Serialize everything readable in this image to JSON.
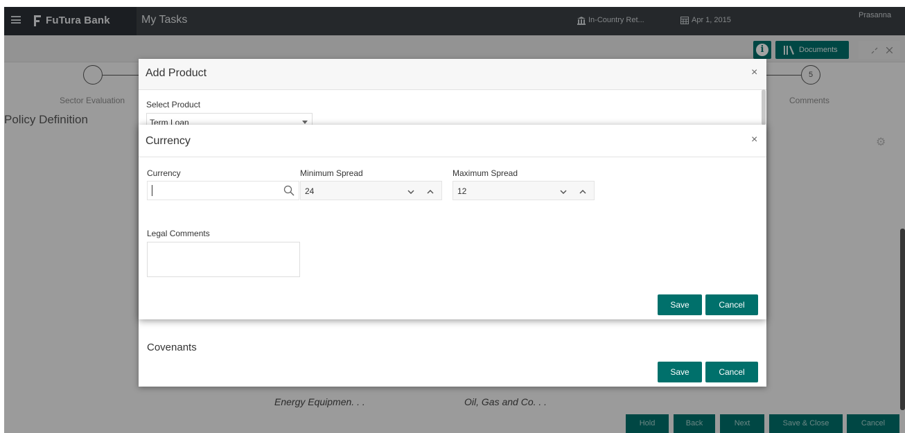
{
  "topbar": {
    "brand": "FuTura Bank",
    "title": "My Tasks",
    "branch": "In-Country Ret...",
    "date": "Apr 1, 2015",
    "user": "Prasanna"
  },
  "toolbar": {
    "documents_label": "Documents"
  },
  "steps": [
    {
      "label": "Sector Evaluation"
    },
    {
      "label": "Comments",
      "number": "5"
    }
  ],
  "page": {
    "heading": "Policy Definition"
  },
  "cards": [
    {
      "label": "Energy Equipmen. . ."
    },
    {
      "label": "Oil, Gas and Co. . ."
    }
  ],
  "actions": {
    "hold": "Hold",
    "back": "Back",
    "next": "Next",
    "save_close": "Save & Close",
    "cancel": "Cancel"
  },
  "add_product_modal": {
    "title": "Add Product",
    "select_product_label": "Select Product",
    "select_product_value": "Term Loan",
    "covenants_heading": "Covenants",
    "save_label": "Save",
    "cancel_label": "Cancel"
  },
  "currency_modal": {
    "title": "Currency",
    "currency_label": "Currency",
    "currency_value": "",
    "min_spread_label": "Minimum Spread",
    "min_spread_value": "24",
    "max_spread_label": "Maximum Spread",
    "max_spread_value": "12",
    "legal_comments_label": "Legal Comments",
    "legal_comments_value": "",
    "save_label": "Save",
    "cancel_label": "Cancel"
  },
  "colors": {
    "accent": "#00706b",
    "topbar": "#3a3f44"
  }
}
